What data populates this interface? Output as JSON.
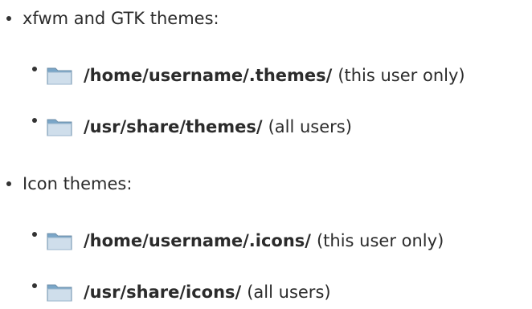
{
  "sections": [
    {
      "heading": "xfwm and GTK themes:",
      "items": [
        {
          "path": "/home/username/.themes/",
          "note": "(this user only)",
          "icon": "folder-icon"
        },
        {
          "path": "/usr/share/themes/",
          "note": "(all users)",
          "icon": "folder-icon"
        }
      ]
    },
    {
      "heading": "Icon themes:",
      "items": [
        {
          "path": "/home/username/.icons/",
          "note": "(this user only)",
          "icon": "folder-icon"
        },
        {
          "path": "/usr/share/icons/",
          "note": "(all users)",
          "icon": "folder-icon"
        }
      ]
    }
  ],
  "colors": {
    "text": "#2b2b2b",
    "folder_body": "#7aa6c8",
    "folder_front": "#cfdeeb",
    "folder_edge": "#6f8fa8"
  }
}
